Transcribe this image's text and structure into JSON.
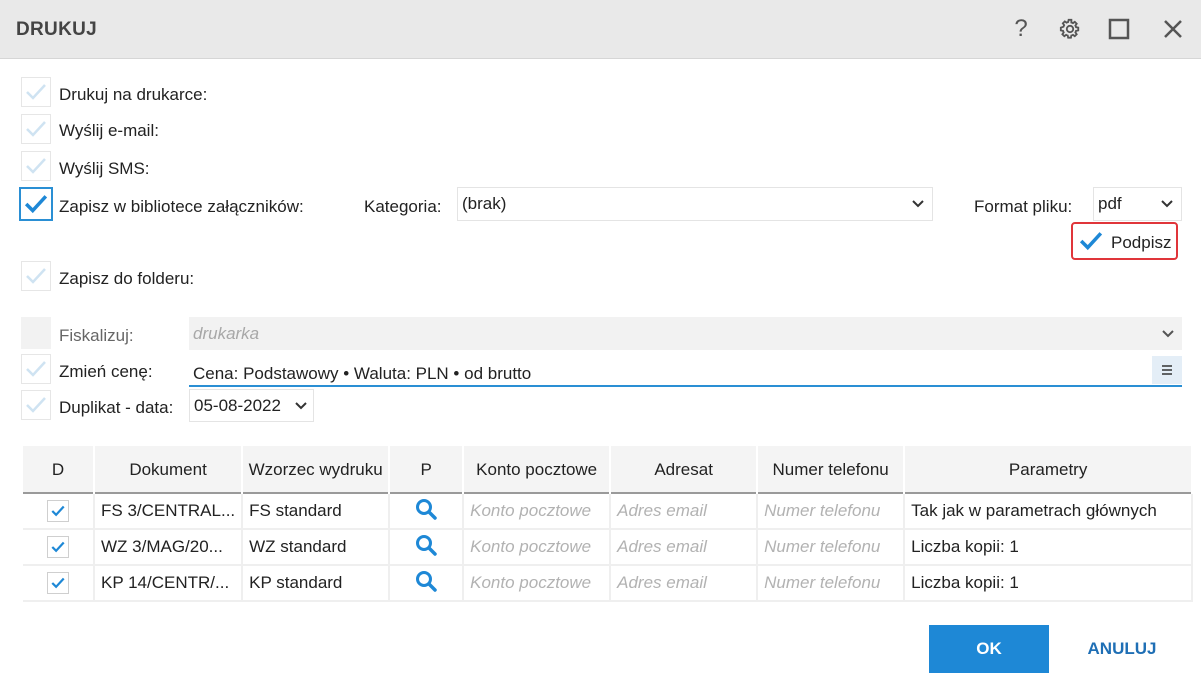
{
  "window": {
    "title": "DRUKUJ"
  },
  "options": {
    "print": {
      "label": "Drukuj na drukarce:",
      "checked": false
    },
    "email": {
      "label": "Wyślij e-mail:",
      "checked": false
    },
    "sms": {
      "label": "Wyślij SMS:",
      "checked": false
    },
    "library": {
      "label": "Zapisz w bibliotece załączników:",
      "checked": true
    },
    "category": {
      "label": "Kategoria:",
      "value": "(brak)"
    },
    "format": {
      "label": "Format pliku:",
      "value": "pdf"
    },
    "sign": {
      "label": "Podpisz",
      "checked": true
    },
    "folder": {
      "label": "Zapisz do folderu:",
      "checked": false
    },
    "fiscal": {
      "label": "Fiskalizuj:",
      "placeholder": "drukarka"
    },
    "price": {
      "label": "Zmień cenę:",
      "value": "Cena: Podstawowy • Waluta: PLN • od brutto"
    },
    "duplicate": {
      "label": "Duplikat - data:",
      "value": "05-08-2022"
    }
  },
  "table": {
    "headers": [
      "D",
      "Dokument",
      "Wzorzec wydruku",
      "P",
      "Konto pocztowe",
      "Adresat",
      "Numer telefonu",
      "Parametry"
    ],
    "rows": [
      {
        "doc": "FS 3/CENTRAL...",
        "template": "FS standard",
        "account": "Konto pocztowe",
        "addressee": "Adres email",
        "phone": "Numer telefonu",
        "params": "Tak jak w parametrach głównych"
      },
      {
        "doc": "WZ 3/MAG/20...",
        "template": "WZ standard",
        "account": "Konto pocztowe",
        "addressee": "Adres email",
        "phone": "Numer telefonu",
        "params": "Liczba kopii: 1"
      },
      {
        "doc": "KP 14/CENTR/...",
        "template": "KP standard",
        "account": "Konto pocztowe",
        "addressee": "Adres email",
        "phone": "Numer telefonu",
        "params": "Liczba kopii: 1"
      }
    ]
  },
  "buttons": {
    "ok": "OK",
    "cancel": "ANULUJ"
  },
  "colors": {
    "accent": "#1e88d6",
    "highlight": "#e0353a",
    "check": "#2a8fd4"
  }
}
